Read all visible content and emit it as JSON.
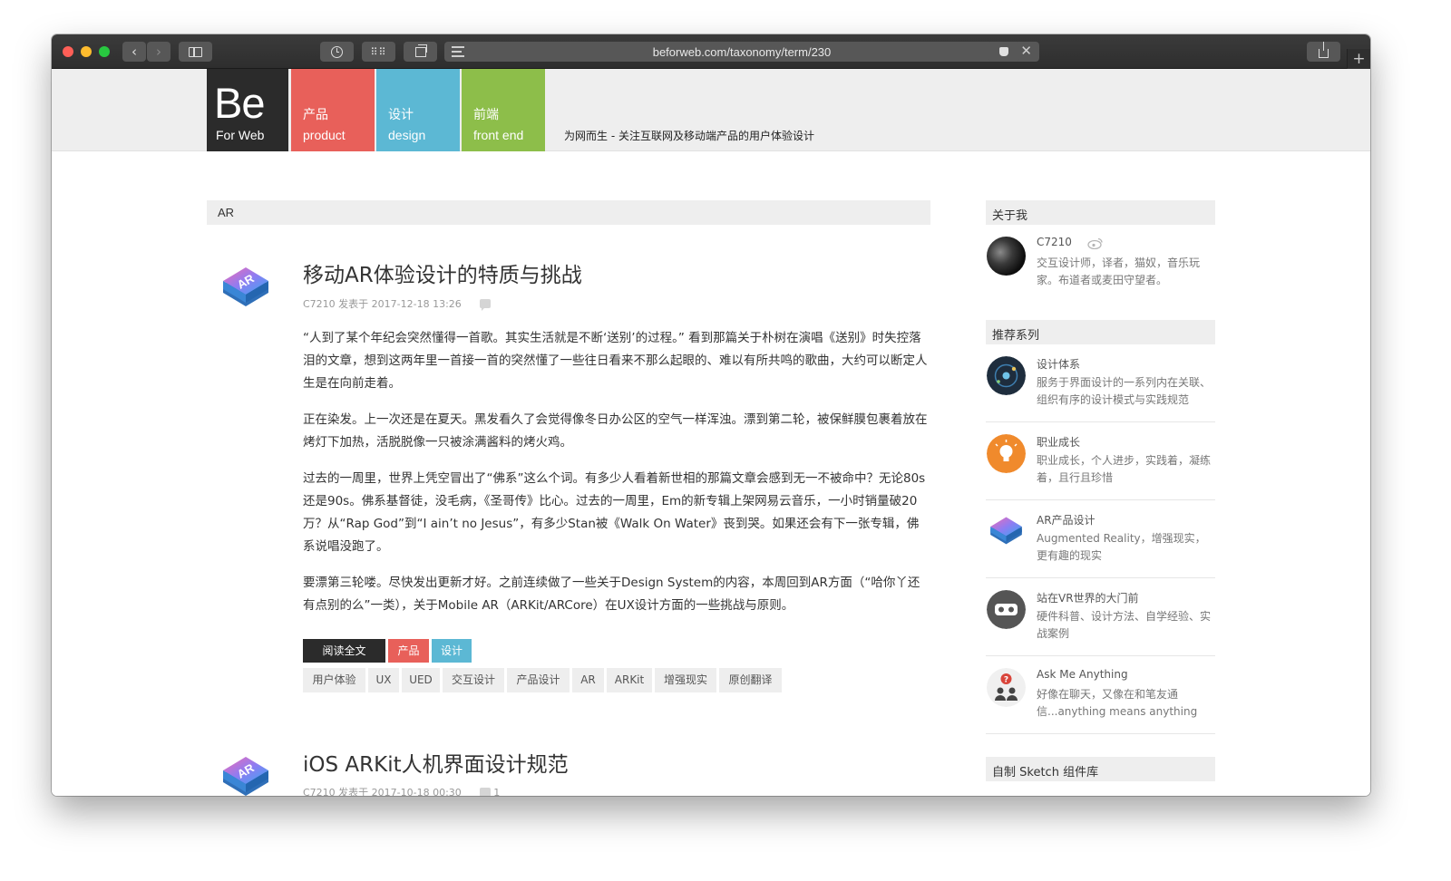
{
  "browser": {
    "url": "beforweb.com/taxonomy/term/230",
    "close_glyph": "✕",
    "plus_glyph": "+",
    "icons": [
      "back-icon",
      "forward-icon",
      "sidebar-icon",
      "history-icon",
      "grid-icon",
      "tabs-icon",
      "reader-icon",
      "extension-icon",
      "share-icon"
    ]
  },
  "header": {
    "logo_big": "Be",
    "logo_small": "For Web",
    "nav": [
      {
        "zh": "产品",
        "en": "product",
        "color": "#e8605a"
      },
      {
        "zh": "设计",
        "en": "design",
        "color": "#5cb8d4"
      },
      {
        "zh": "前端",
        "en": "front end",
        "color": "#8dbe4a"
      }
    ],
    "tagline": "为网而生 - 关注互联网及移动端产品的用户体验设计"
  },
  "category": {
    "label": "AR"
  },
  "posts": [
    {
      "title": "移动AR体验设计的特质与挑战",
      "meta": "C7210 发表于 2017-12-18 13:26",
      "paragraphs": [
        "“人到了某个年纪会突然懂得一首歌。其实生活就是不断‘送别’的过程。” 看到那篇关于朴树在演唱《送别》时失控落泪的文章，想到这两年里一首接一首的突然懂了一些往日看来不那么起眼的、难以有所共鸣的歌曲，大约可以断定人生是在向前走着。",
        "正在染发。上一次还是在夏天。黑发看久了会觉得像冬日办公区的空气一样浑浊。漂到第二轮，被保鲜膜包裹着放在烤灯下加热，活脱脱像一只被涂满酱料的烤火鸡。",
        "过去的一周里，世界上凭空冒出了“佛系”这么个词。有多少人看着新世相的那篇文章会感到无一不被命中？无论80s还是90s。佛系基督徒，没毛病，《圣哥传》比心。过去的一周里，Em的新专辑上架网易云音乐，一小时销量破20万？从“Rap God”到“I ain’t no Jesus”，有多少Stan被《Walk On Water》丧到哭。如果还会有下一张专辑，佛系说唱没跑了。",
        "要漂第三轮喽。尽快发出更新才好。之前连续做了一些关于Design System的内容，本周回到AR方面（“哈你丫还有点别的么”一类），关于Mobile AR（ARKit/ARCore）在UX设计方面的一些挑战与原则。"
      ],
      "read_more": "阅读全文",
      "categories": [
        {
          "label": "产品",
          "color": "#e8605a"
        },
        {
          "label": "设计",
          "color": "#5cb8d4"
        }
      ],
      "tags": [
        "用户体验",
        "UX",
        "UED",
        "交互设计",
        "产品设计",
        "AR",
        "ARKit",
        "增强现实",
        "原创翻译"
      ]
    },
    {
      "title": "iOS ARKit人机界面设计规范",
      "meta": "C7210 发表于 2017-10-18 00:30",
      "comments": "1"
    }
  ],
  "sidebar": {
    "about": {
      "heading": "关于我",
      "name": "C7210",
      "bio": "交互设计师，译者，猫奴，音乐玩家。布道者或麦田守望者。"
    },
    "series": {
      "heading": "推荐系列",
      "items": [
        {
          "title": "设计体系",
          "desc": "服务于界面设计的一系列内在关联、组织有序的设计模式与实践规范"
        },
        {
          "title": "职业成长",
          "desc": "职业成长，个人进步，实践着，凝练着，且行且珍惜"
        },
        {
          "title": "AR产品设计",
          "desc": "Augmented Reality，增强现实，更有趣的现实"
        },
        {
          "title": "站在VR世界的大门前",
          "desc": "硬件科普、设计方法、自学经验、实战案例"
        },
        {
          "title": "Ask Me Anything",
          "desc": "好像在聊天，又像在和笔友通信...anything means anything"
        }
      ]
    },
    "sketch": {
      "heading": "自制 Sketch 组件库"
    }
  }
}
